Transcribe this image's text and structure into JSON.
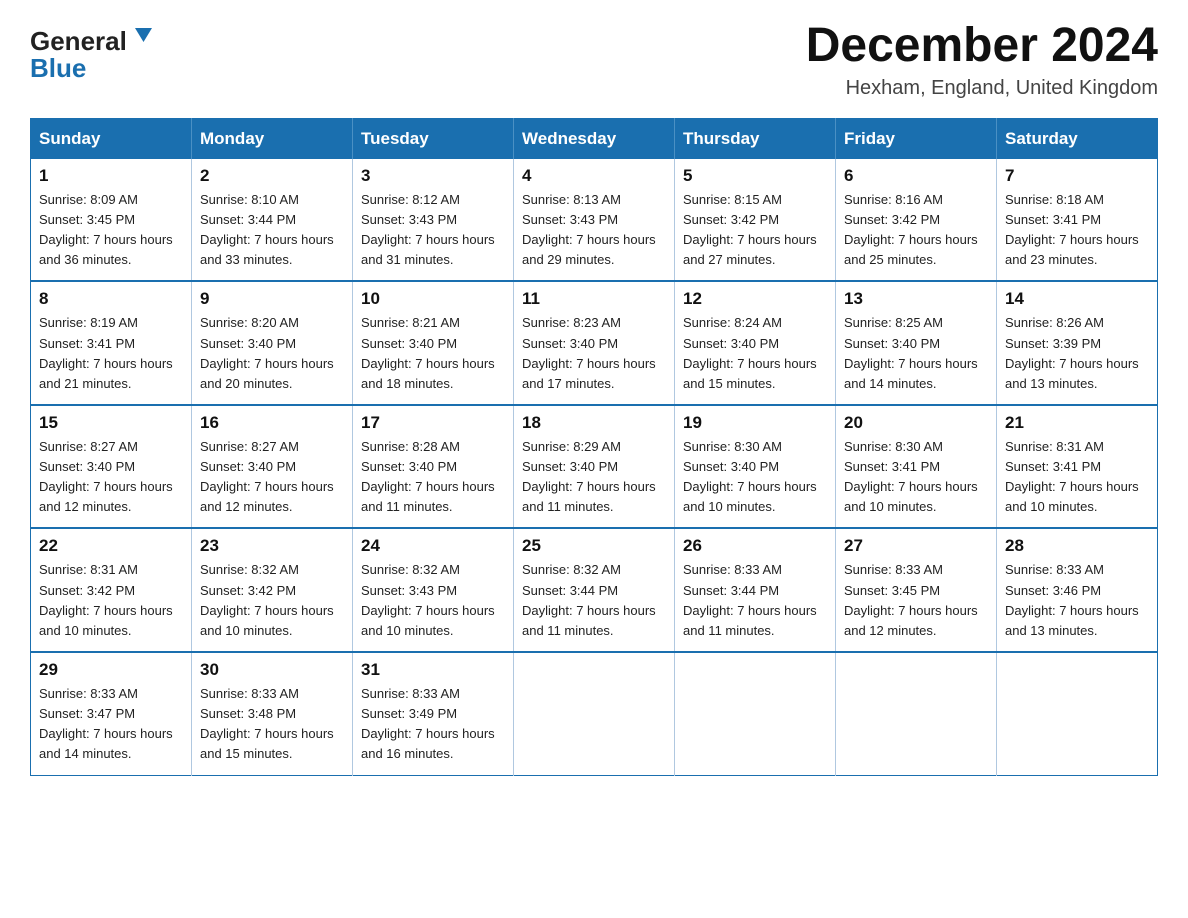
{
  "header": {
    "logo_line1": "General",
    "logo_line2": "Blue",
    "month_title": "December 2024",
    "subtitle": "Hexham, England, United Kingdom"
  },
  "weekdays": [
    "Sunday",
    "Monday",
    "Tuesday",
    "Wednesday",
    "Thursday",
    "Friday",
    "Saturday"
  ],
  "weeks": [
    [
      {
        "day": "1",
        "sunrise": "8:09 AM",
        "sunset": "3:45 PM",
        "daylight": "7 hours and 36 minutes."
      },
      {
        "day": "2",
        "sunrise": "8:10 AM",
        "sunset": "3:44 PM",
        "daylight": "7 hours and 33 minutes."
      },
      {
        "day": "3",
        "sunrise": "8:12 AM",
        "sunset": "3:43 PM",
        "daylight": "7 hours and 31 minutes."
      },
      {
        "day": "4",
        "sunrise": "8:13 AM",
        "sunset": "3:43 PM",
        "daylight": "7 hours and 29 minutes."
      },
      {
        "day": "5",
        "sunrise": "8:15 AM",
        "sunset": "3:42 PM",
        "daylight": "7 hours and 27 minutes."
      },
      {
        "day": "6",
        "sunrise": "8:16 AM",
        "sunset": "3:42 PM",
        "daylight": "7 hours and 25 minutes."
      },
      {
        "day": "7",
        "sunrise": "8:18 AM",
        "sunset": "3:41 PM",
        "daylight": "7 hours and 23 minutes."
      }
    ],
    [
      {
        "day": "8",
        "sunrise": "8:19 AM",
        "sunset": "3:41 PM",
        "daylight": "7 hours and 21 minutes."
      },
      {
        "day": "9",
        "sunrise": "8:20 AM",
        "sunset": "3:40 PM",
        "daylight": "7 hours and 20 minutes."
      },
      {
        "day": "10",
        "sunrise": "8:21 AM",
        "sunset": "3:40 PM",
        "daylight": "7 hours and 18 minutes."
      },
      {
        "day": "11",
        "sunrise": "8:23 AM",
        "sunset": "3:40 PM",
        "daylight": "7 hours and 17 minutes."
      },
      {
        "day": "12",
        "sunrise": "8:24 AM",
        "sunset": "3:40 PM",
        "daylight": "7 hours and 15 minutes."
      },
      {
        "day": "13",
        "sunrise": "8:25 AM",
        "sunset": "3:40 PM",
        "daylight": "7 hours and 14 minutes."
      },
      {
        "day": "14",
        "sunrise": "8:26 AM",
        "sunset": "3:39 PM",
        "daylight": "7 hours and 13 minutes."
      }
    ],
    [
      {
        "day": "15",
        "sunrise": "8:27 AM",
        "sunset": "3:40 PM",
        "daylight": "7 hours and 12 minutes."
      },
      {
        "day": "16",
        "sunrise": "8:27 AM",
        "sunset": "3:40 PM",
        "daylight": "7 hours and 12 minutes."
      },
      {
        "day": "17",
        "sunrise": "8:28 AM",
        "sunset": "3:40 PM",
        "daylight": "7 hours and 11 minutes."
      },
      {
        "day": "18",
        "sunrise": "8:29 AM",
        "sunset": "3:40 PM",
        "daylight": "7 hours and 11 minutes."
      },
      {
        "day": "19",
        "sunrise": "8:30 AM",
        "sunset": "3:40 PM",
        "daylight": "7 hours and 10 minutes."
      },
      {
        "day": "20",
        "sunrise": "8:30 AM",
        "sunset": "3:41 PM",
        "daylight": "7 hours and 10 minutes."
      },
      {
        "day": "21",
        "sunrise": "8:31 AM",
        "sunset": "3:41 PM",
        "daylight": "7 hours and 10 minutes."
      }
    ],
    [
      {
        "day": "22",
        "sunrise": "8:31 AM",
        "sunset": "3:42 PM",
        "daylight": "7 hours and 10 minutes."
      },
      {
        "day": "23",
        "sunrise": "8:32 AM",
        "sunset": "3:42 PM",
        "daylight": "7 hours and 10 minutes."
      },
      {
        "day": "24",
        "sunrise": "8:32 AM",
        "sunset": "3:43 PM",
        "daylight": "7 hours and 10 minutes."
      },
      {
        "day": "25",
        "sunrise": "8:32 AM",
        "sunset": "3:44 PM",
        "daylight": "7 hours and 11 minutes."
      },
      {
        "day": "26",
        "sunrise": "8:33 AM",
        "sunset": "3:44 PM",
        "daylight": "7 hours and 11 minutes."
      },
      {
        "day": "27",
        "sunrise": "8:33 AM",
        "sunset": "3:45 PM",
        "daylight": "7 hours and 12 minutes."
      },
      {
        "day": "28",
        "sunrise": "8:33 AM",
        "sunset": "3:46 PM",
        "daylight": "7 hours and 13 minutes."
      }
    ],
    [
      {
        "day": "29",
        "sunrise": "8:33 AM",
        "sunset": "3:47 PM",
        "daylight": "7 hours and 14 minutes."
      },
      {
        "day": "30",
        "sunrise": "8:33 AM",
        "sunset": "3:48 PM",
        "daylight": "7 hours and 15 minutes."
      },
      {
        "day": "31",
        "sunrise": "8:33 AM",
        "sunset": "3:49 PM",
        "daylight": "7 hours and 16 minutes."
      },
      null,
      null,
      null,
      null
    ]
  ]
}
